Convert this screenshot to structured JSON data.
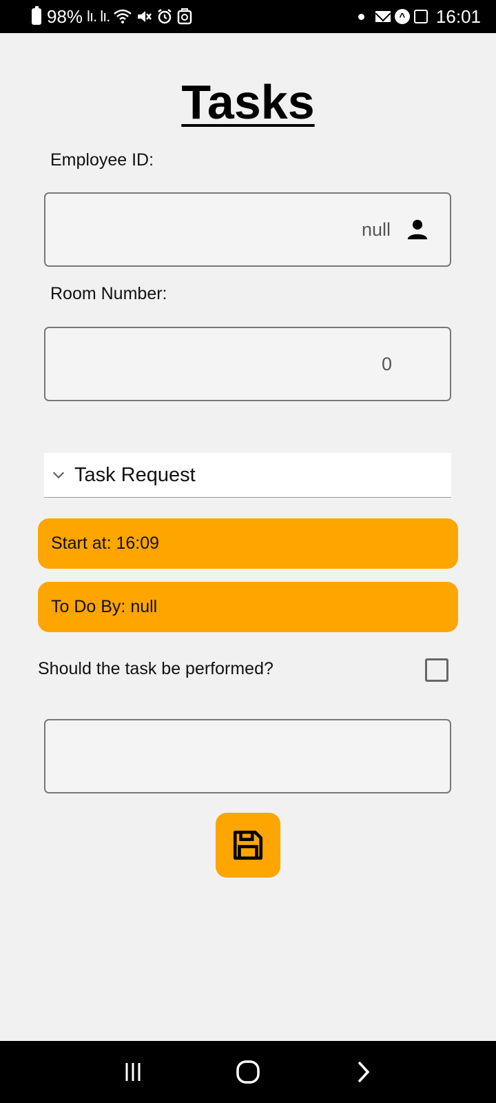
{
  "status_bar": {
    "battery": "98%",
    "signal_icons": "lı. lı.",
    "time": "16:01"
  },
  "page": {
    "title": "Tasks"
  },
  "form": {
    "employee_label": "Employee ID:",
    "employee_value": "null",
    "room_label": "Room Number:",
    "room_value": "0",
    "dropdown_label": "Task Request",
    "start_label": "Start at: 16:09",
    "todo_label": "To Do By: null",
    "perform_question": "Should the task be performed?",
    "perform_checked": false,
    "notes_value": ""
  },
  "colors": {
    "accent": "#ffa500",
    "background": "#f1f1f1"
  },
  "icons": {
    "employee_field": "person-icon",
    "dropdown": "chevron-down-icon",
    "save": "save-icon"
  }
}
